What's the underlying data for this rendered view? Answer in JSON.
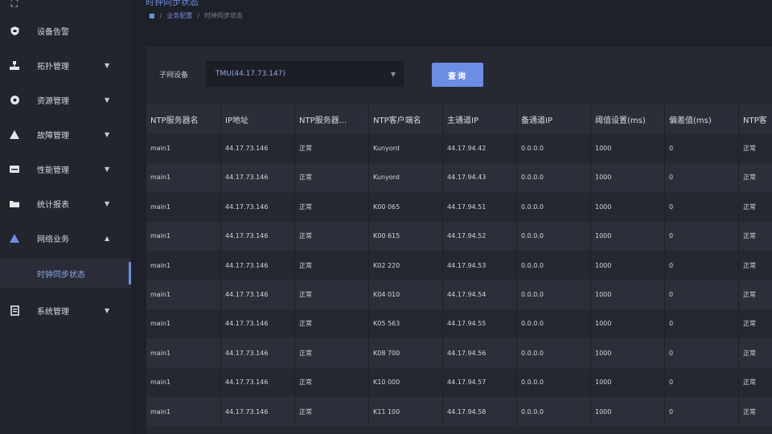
{
  "sidebar": {
    "items": [
      {
        "label": "设备告警",
        "icon": "shield-icon"
      },
      {
        "label": "拓扑管理",
        "icon": "topology-icon"
      },
      {
        "label": "资源管理",
        "icon": "resource-icon"
      },
      {
        "label": "故障管理",
        "icon": "warning-icon"
      },
      {
        "label": "性能管理",
        "icon": "server-icon"
      },
      {
        "label": "统计报表",
        "icon": "folder-icon"
      },
      {
        "label": "网络业务",
        "icon": "network-icon"
      },
      {
        "label": "时钟同步状态",
        "icon": ""
      },
      {
        "label": "系统管理",
        "icon": "system-icon"
      }
    ]
  },
  "header": {
    "title": "时钟同步状态",
    "breadcrumb": {
      "home_icon": "home-icon",
      "section": "业务配置",
      "current": "时钟同步状态"
    }
  },
  "filter": {
    "label": "子网设备",
    "selected": "TMU(44.17.73.147)",
    "query_label": "查询"
  },
  "table": {
    "columns": [
      "NTP服务器名",
      "IP地址",
      "NTP服务器...",
      "NTP客户端名",
      "主通道IP",
      "备通道IP",
      "阈值设置(ms)",
      "偏差值(ms)",
      "NTP客"
    ],
    "rows": [
      [
        "main1",
        "44.17.73.146",
        "正常",
        "Kunyord",
        "44.17.94.42",
        "0.0.0.0",
        "1000",
        "0",
        "正常"
      ],
      [
        "main1",
        "44.17.73.146",
        "正常",
        "Kunyord",
        "44.17.94.43",
        "0.0.0.0",
        "1000",
        "0",
        "正常"
      ],
      [
        "main1",
        "44.17.73.146",
        "正常",
        "K00 065",
        "44.17.94.51",
        "0.0.0.0",
        "1000",
        "0",
        "正常"
      ],
      [
        "main1",
        "44.17.73.146",
        "正常",
        "K00 615",
        "44.17.94.52",
        "0.0.0.0",
        "1000",
        "0",
        "正常"
      ],
      [
        "main1",
        "44.17.73.146",
        "正常",
        "K02 220",
        "44.17.94.53",
        "0.0.0.0",
        "1000",
        "0",
        "正常"
      ],
      [
        "main1",
        "44.17.73.146",
        "正常",
        "K04 010",
        "44.17.94.54",
        "0.0.0.0",
        "1000",
        "0",
        "正常"
      ],
      [
        "main1",
        "44.17.73.146",
        "正常",
        "K05 563",
        "44.17.94.55",
        "0.0.0.0",
        "1000",
        "0",
        "正常"
      ],
      [
        "main1",
        "44.17.73.146",
        "正常",
        "K08 700",
        "44.17.94.56",
        "0.0.0.0",
        "1000",
        "0",
        "正常"
      ],
      [
        "main1",
        "44.17.73.146",
        "正常",
        "K10 000",
        "44.17.94.57",
        "0.0.0.0",
        "1000",
        "0",
        "正常"
      ],
      [
        "main1",
        "44.17.73.146",
        "正常",
        "K11 100",
        "44.17.94.58",
        "0.0.0.0",
        "1000",
        "0",
        "正常"
      ]
    ]
  },
  "colors": {
    "accent": "#6b8de3",
    "background": "#1f2128",
    "sidebar": "#23252d"
  }
}
